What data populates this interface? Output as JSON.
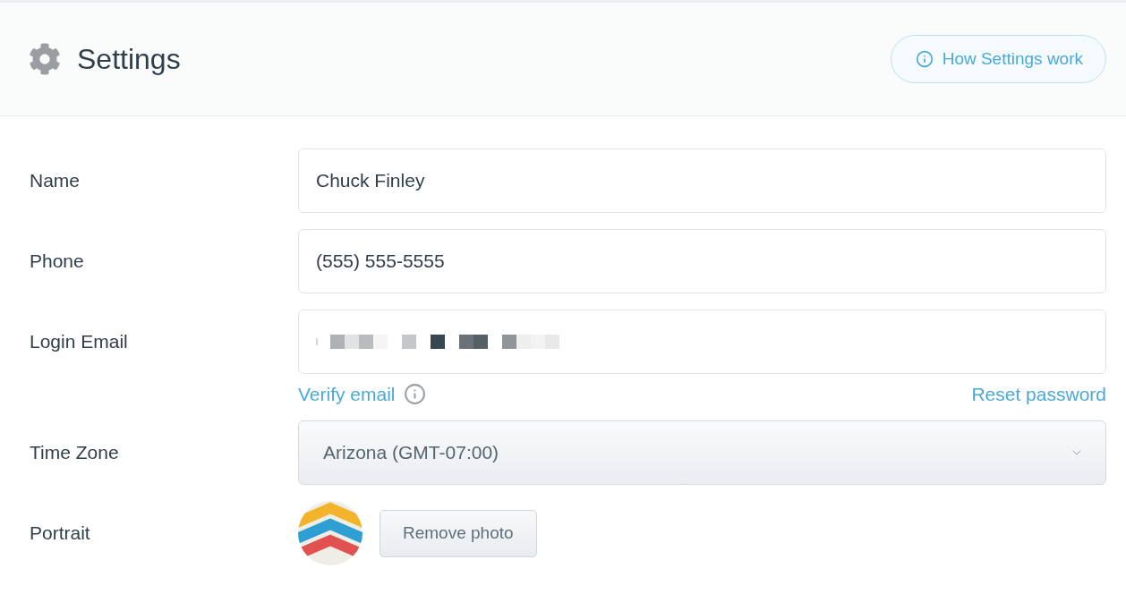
{
  "header": {
    "title": "Settings",
    "help_button": "How Settings work"
  },
  "fields": [
    {
      "kind": "text",
      "label": "Name",
      "value": "Chuck Finley"
    },
    {
      "kind": "text",
      "label": "Phone",
      "value": "(555) 555-5555"
    },
    {
      "kind": "redacted",
      "label": "Login Email",
      "actions": [
        {
          "label": "Verify email",
          "info": true
        },
        {
          "label": "Reset password",
          "info": false
        }
      ]
    },
    {
      "kind": "select",
      "label": "Time Zone",
      "value": "Arizona (GMT-07:00)"
    },
    {
      "kind": "portrait",
      "label": "Portrait",
      "button": "Remove photo"
    }
  ]
}
